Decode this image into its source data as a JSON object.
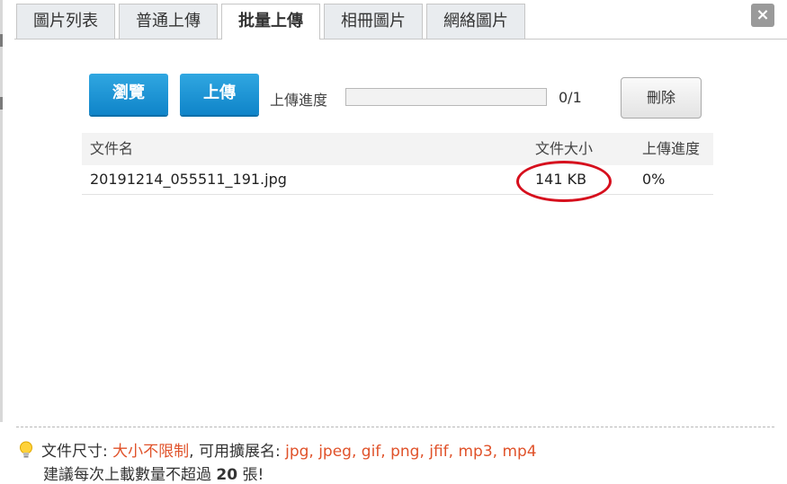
{
  "tabs": [
    {
      "label": "圖片列表",
      "active": false
    },
    {
      "label": "普通上傳",
      "active": false
    },
    {
      "label": "批量上傳",
      "active": true
    },
    {
      "label": "相冊圖片",
      "active": false
    },
    {
      "label": "網絡圖片",
      "active": false
    }
  ],
  "close_label": "×",
  "toolbar": {
    "browse_label": "瀏覽",
    "upload_label": "上傳",
    "progress_label": "上傳進度",
    "progress_fraction": 0,
    "progress_count": "0/1",
    "delete_label": "刪除"
  },
  "table": {
    "headers": {
      "name": "文件名",
      "size": "文件大小",
      "progress": "上傳進度"
    },
    "rows": [
      {
        "name": "20191214_055511_191.jpg",
        "size": "141 KB",
        "progress": "0%"
      }
    ]
  },
  "footer": {
    "size_label": "文件尺寸:",
    "size_value": "大小不限制",
    "ext_label": ", 可用擴展名:",
    "ext_value": "jpg, jpeg, gif, png, jfif, mp3, mp4",
    "advice_prefix": "建議每次上載數量不超過",
    "advice_count": "20",
    "advice_suffix": "張!"
  },
  "colors": {
    "accent": "#e0522a",
    "primary_button": "#1a93d4",
    "highlight_ring": "#d60f1d"
  }
}
